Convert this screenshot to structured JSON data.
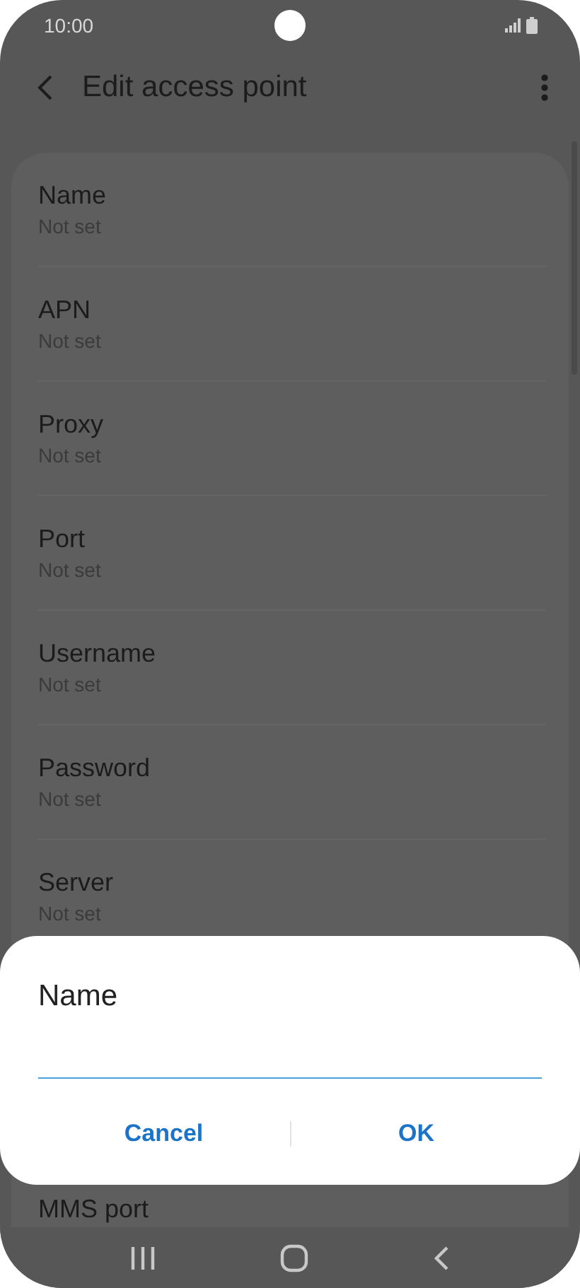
{
  "status_bar": {
    "time": "10:00"
  },
  "header": {
    "title": "Edit access point"
  },
  "settings": [
    {
      "label": "Name",
      "value": "Not set"
    },
    {
      "label": "APN",
      "value": "Not set"
    },
    {
      "label": "Proxy",
      "value": "Not set"
    },
    {
      "label": "Port",
      "value": "Not set"
    },
    {
      "label": "Username",
      "value": "Not set"
    },
    {
      "label": "Password",
      "value": "Not set"
    },
    {
      "label": "Server",
      "value": "Not set"
    },
    {
      "label": "MMS port"
    }
  ],
  "dialog": {
    "title": "Name",
    "buttons": [
      "Cancel",
      "OK"
    ]
  }
}
